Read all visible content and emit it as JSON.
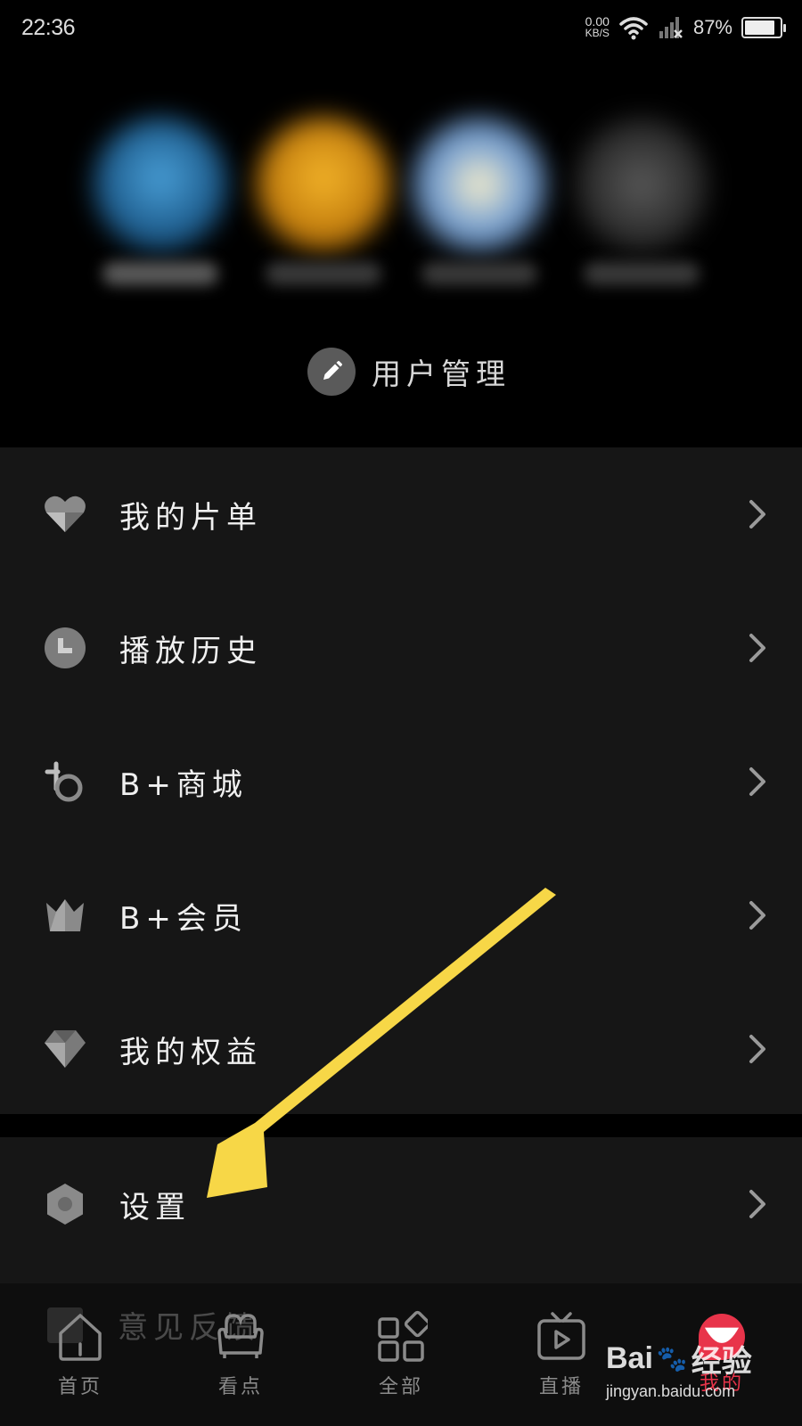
{
  "status_bar": {
    "time": "22:36",
    "net_speed_value": "0.00",
    "net_speed_unit": "KB/S",
    "battery_percent": "87%",
    "battery_level": 0.87
  },
  "profiles": {
    "user_management_label": "用户管理"
  },
  "menu": {
    "items": [
      {
        "label": "我的片单",
        "icon": "heart-icon"
      },
      {
        "label": "播放历史",
        "icon": "clock-icon"
      },
      {
        "label": "B+商城",
        "icon": "bplus-mall-icon"
      },
      {
        "label": "B+会员",
        "icon": "crown-icon"
      },
      {
        "label": "我的权益",
        "icon": "gem-icon"
      }
    ],
    "settings": {
      "label": "设置",
      "icon": "hexagon-gear-icon"
    },
    "ghost_item": {
      "label": "意见反馈"
    }
  },
  "bottom_nav": {
    "items": [
      {
        "label": "首页",
        "icon": "home-icon"
      },
      {
        "label": "看点",
        "icon": "sofa-icon"
      },
      {
        "label": "全部",
        "icon": "grid-icon"
      },
      {
        "label": "直播",
        "icon": "tv-play-icon"
      },
      {
        "label": "我的",
        "icon": "profile-icon"
      }
    ]
  },
  "watermark": {
    "brand": "Bai",
    "brand_suffix": "经验",
    "url": "jingyan.baidu.com"
  },
  "colors": {
    "background": "#000000",
    "menu_background": "#161616",
    "accent_red": "#e8344a",
    "arrow_yellow": "#f7d747"
  }
}
